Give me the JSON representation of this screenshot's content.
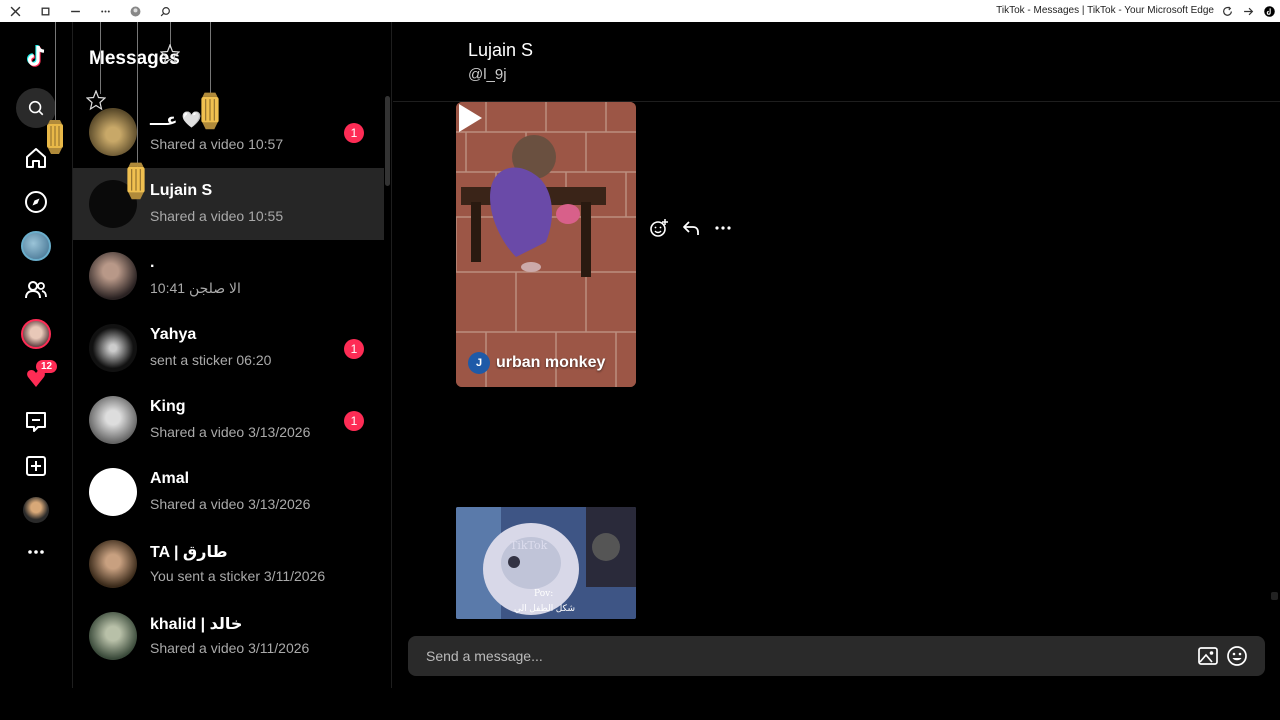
{
  "browser": {
    "title": "TikTok - Messages | TikTok - Your Microsoft Edge"
  },
  "rail": {
    "items": [
      {
        "name": "tiktok-logo",
        "icon": "tiktok-logo"
      },
      {
        "name": "search",
        "icon": "search-icon"
      },
      {
        "name": "home",
        "icon": "home-icon"
      },
      {
        "name": "explore",
        "icon": "compass-icon"
      },
      {
        "name": "live",
        "icon": "live-avatar"
      },
      {
        "name": "following",
        "icon": "people-icon"
      },
      {
        "name": "friends",
        "icon": "friend-avatar"
      },
      {
        "name": "activity",
        "icon": "inbox-icon",
        "badge": "12"
      },
      {
        "name": "messages",
        "icon": "message-icon"
      },
      {
        "name": "upload",
        "icon": "plus-square-icon"
      },
      {
        "name": "profile",
        "icon": "profile-avatar"
      },
      {
        "name": "more",
        "icon": "more-icon"
      }
    ]
  },
  "conversations": {
    "title": "Messages",
    "items": [
      {
        "name": "عـــ 🤍",
        "preview": "Shared a video",
        "time": "10:57",
        "unread": "1",
        "avatar_color": "#6b5b3a"
      },
      {
        "name": "Lujain S",
        "preview": "Shared a video",
        "time": "10:55",
        "unread": "",
        "avatar_color": "#0a0a0a",
        "active": true
      },
      {
        "name": ".",
        "preview": "الا صلجن",
        "time": "10:41",
        "unread": "",
        "avatar_color": "#3a3030"
      },
      {
        "name": "Yahya",
        "preview": "sent a sticker",
        "time": "06:20",
        "unread": "1",
        "avatar_color": "#222"
      },
      {
        "name": "King",
        "preview": "Shared a video",
        "time": "3/13/2026",
        "unread": "1",
        "avatar_color": "#9a9a9a"
      },
      {
        "name": "Amal",
        "preview": "Shared a video",
        "time": "3/13/2026",
        "unread": "",
        "avatar_color": "#ffffff"
      },
      {
        "name": "TA | طارق",
        "preview": "You sent a sticker",
        "time": "3/11/2026",
        "unread": "",
        "avatar_color": "#4a3a2a"
      },
      {
        "name": "khalid | خالد",
        "preview": "Shared a video",
        "time": "3/11/2026",
        "unread": "",
        "avatar_color": "#5a6a5a"
      }
    ]
  },
  "chat": {
    "contact_name": "Lujain S",
    "contact_handle": "@l_9j",
    "shared_video": {
      "author_initial": "J",
      "author_name": "urban monkey"
    },
    "second_video": {
      "overlay_line1": "TikTok",
      "overlay_line2": "Pov:",
      "overlay_line3": "شكل الطفل الي"
    },
    "composer": {
      "placeholder": "Send a message..."
    }
  },
  "colors": {
    "accent": "#fe2c55",
    "background": "#000000",
    "active_row": "#262626",
    "composer_bg": "#2a2a2a"
  }
}
